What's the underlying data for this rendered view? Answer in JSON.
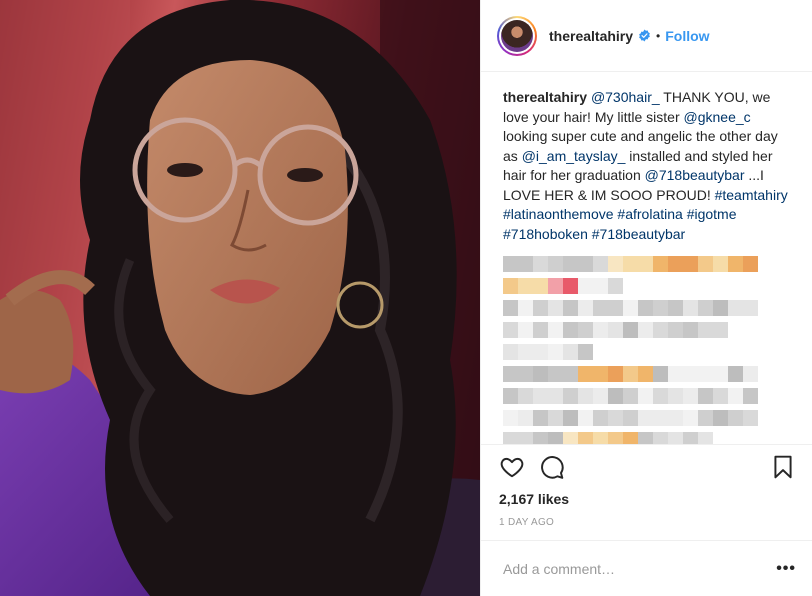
{
  "post": {
    "username": "therealtahiry",
    "follow_label": "Follow",
    "separator": "•"
  },
  "caption": {
    "username": "therealtahiry",
    "seg1": " ",
    "mention1": "@730hair_",
    "seg2": " THANK YOU, we love your hair! My little sister ",
    "mention2": "@gknee_c",
    "seg3": " looking super cute and angelic the other day as ",
    "mention3": "@i_am_tayslay_",
    "seg4": " installed and styled her hair for her graduation ",
    "mention4": "@718beautybar",
    "seg5": " ...I LOVE HER & IM SOOO PROUD! ",
    "tag1": "#teamtahiry",
    "tag2": "#latinaonthemove",
    "tag3": "#afrolatina",
    "tag4": "#igotme",
    "tag5": "#718hoboken",
    "tag6": "#718beautybar"
  },
  "engagement": {
    "likes": "2,167 likes",
    "time_ago": "1 DAY AGO"
  },
  "comment_box": {
    "placeholder": "Add a comment…",
    "more_label": "•••"
  },
  "colors": {
    "link": "#003569",
    "follow": "#3897f0",
    "verified": "#3897f0",
    "muted": "#999999",
    "border": "#efefef"
  },
  "icons": {
    "heart": "heart-icon",
    "comment": "comment-icon",
    "save": "bookmark-icon",
    "verified": "verified-badge-icon"
  }
}
